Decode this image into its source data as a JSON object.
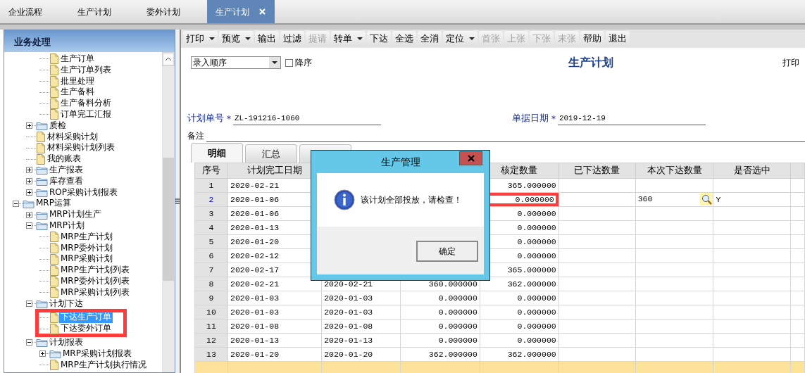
{
  "top_tabs": [
    {
      "label": "企业流程",
      "selected": false,
      "closable": false
    },
    {
      "label": "生产计划",
      "selected": false,
      "closable": false
    },
    {
      "label": "委外计划",
      "selected": false,
      "closable": false
    },
    {
      "label": "生产计划",
      "selected": true,
      "closable": true
    }
  ],
  "sidebar": {
    "title": "业务处理",
    "tree": [
      {
        "kind": "scrolled",
        "children": [
          {
            "kind": "scrolled",
            "children": [
              {
                "kind": "file",
                "label": "生产订单",
                "selected": false
              },
              {
                "kind": "file",
                "label": "生产订单列表",
                "selected": false
              },
              {
                "kind": "file",
                "label": "批里处理",
                "selected": false
              },
              {
                "kind": "file",
                "label": "生产备料",
                "selected": false
              },
              {
                "kind": "file",
                "label": "生产备料分析",
                "selected": false
              },
              {
                "kind": "file",
                "label": "订单完工汇报",
                "selected": false
              }
            ]
          },
          {
            "kind": "folder",
            "label": "质检",
            "expanded": false
          },
          {
            "kind": "file",
            "label": "材料采购计划",
            "selected": false
          },
          {
            "kind": "file",
            "label": "材料采购计划列表",
            "selected": false
          },
          {
            "kind": "file",
            "label": "我的账表",
            "selected": false
          },
          {
            "kind": "folder",
            "label": "生产报表",
            "expanded": false
          },
          {
            "kind": "folder",
            "label": "库存查看",
            "expanded": false
          },
          {
            "kind": "folder",
            "label": "ROP采购计划报表",
            "expanded": false
          }
        ]
      },
      {
        "kind": "folder",
        "label": "MRP运算",
        "expanded": true,
        "children": [
          {
            "kind": "folder",
            "label": "MRP计划生产",
            "expanded": false
          },
          {
            "kind": "folder",
            "label": "MRP计划",
            "expanded": true,
            "children": [
              {
                "kind": "file",
                "label": "MRP生产计划",
                "selected": false
              },
              {
                "kind": "file",
                "label": "MRP委外计划",
                "selected": false
              },
              {
                "kind": "file",
                "label": "MRP采购计划",
                "selected": false
              },
              {
                "kind": "file",
                "label": "MRP生产计划列表",
                "selected": false
              },
              {
                "kind": "file",
                "label": "MRP委外计划列表",
                "selected": false
              },
              {
                "kind": "file",
                "label": "MRP采购计划列表",
                "selected": false
              }
            ]
          },
          {
            "kind": "folder",
            "label": "计划下达",
            "expanded": true,
            "annotated": true,
            "children": [
              {
                "kind": "file",
                "label": "下达生产订单",
                "selected": true
              },
              {
                "kind": "file",
                "label": "下达委外订单",
                "selected": false
              }
            ]
          },
          {
            "kind": "folder",
            "label": "计划报表",
            "expanded": true,
            "children": [
              {
                "kind": "folder",
                "label": "MRP采购计划报表",
                "expanded": false
              },
              {
                "kind": "file",
                "label": "MRP生产计划执行情况",
                "selected": false
              }
            ]
          }
        ]
      }
    ]
  },
  "toolbar": [
    {
      "label": "打印",
      "dropdown": true,
      "disabled": false
    },
    {
      "label": "预览",
      "dropdown": true,
      "disabled": false
    },
    {
      "label": "输出",
      "dropdown": false,
      "disabled": false
    },
    {
      "label": "过滤",
      "dropdown": false,
      "disabled": false
    },
    {
      "label": "提请",
      "dropdown": false,
      "disabled": true
    },
    {
      "label": "转单",
      "dropdown": true,
      "disabled": false
    },
    {
      "label": "下达",
      "dropdown": false,
      "disabled": false
    },
    {
      "label": "全选",
      "dropdown": false,
      "disabled": false
    },
    {
      "label": "全消",
      "dropdown": false,
      "disabled": false
    },
    {
      "label": "定位",
      "dropdown": true,
      "disabled": false
    },
    {
      "label": "首张",
      "dropdown": false,
      "disabled": true
    },
    {
      "label": "上张",
      "dropdown": false,
      "disabled": true
    },
    {
      "label": "下张",
      "dropdown": false,
      "disabled": true
    },
    {
      "label": "末张",
      "dropdown": false,
      "disabled": true
    },
    {
      "label": "帮助",
      "dropdown": false,
      "disabled": false
    },
    {
      "label": "退出",
      "dropdown": false,
      "disabled": false
    }
  ],
  "sort": {
    "value": "录入顺序",
    "descending_label": "降序",
    "descending": false
  },
  "form_title": "生产计划",
  "print_label": "打印",
  "fields": {
    "plan_no": {
      "label": "计划单号",
      "marker": "*",
      "value": "ZL-191216-1060"
    },
    "doc_date": {
      "label": "单据日期",
      "marker": "*",
      "value": "2019-12-19"
    },
    "remark": {
      "label": "备注"
    }
  },
  "detail_tabs": [
    {
      "label": "明细",
      "selected": true
    },
    {
      "label": "汇总",
      "selected": false
    },
    {
      "selected": false
    }
  ],
  "table": {
    "columns": [
      "序号",
      "计划完工日期",
      null,
      null,
      "核定数量",
      "已下达数量",
      "本次下达数量",
      "是否选中",
      null
    ],
    "rows": [
      {
        "no": "1",
        "plan_date": "2020-02-21",
        "approved_qty": "365.000000",
        "current": false,
        "marked": false
      },
      {
        "no": "2",
        "plan_date": "2020-01-06",
        "approved_qty": "0.000000",
        "this_qty": "360",
        "selected_flag": "Y",
        "current": true,
        "marked": true
      },
      {
        "no": "3",
        "plan_date": "2020-01-06",
        "approved_qty": "0.000000",
        "current": false,
        "marked": false
      },
      {
        "no": "4",
        "plan_date": "2020-01-13",
        "approved_qty": "0.000000",
        "current": false,
        "marked": false
      },
      {
        "no": "5",
        "plan_date": "2020-01-20",
        "approved_qty": "0.000000",
        "current": false,
        "marked": false
      },
      {
        "no": "6",
        "plan_date": "2020-02-12",
        "approved_qty": "0.000000",
        "current": false,
        "marked": false
      },
      {
        "no": "7",
        "plan_date": "2020-02-17",
        "approved_qty": "365.000000",
        "current": false,
        "marked": false
      },
      {
        "no": "8",
        "plan_date": "2020-02-21",
        "column_3": "2020-02-21",
        "column_4": "360.000000",
        "approved_qty": "362.000000",
        "current": false,
        "marked": false
      },
      {
        "no": "9",
        "plan_date": "2020-01-03",
        "column_3": "2020-01-03",
        "column_4": "0.000000",
        "approved_qty": "0.000000",
        "current": false,
        "marked": false
      },
      {
        "no": "10",
        "plan_date": "2020-01-03",
        "column_3": "2020-01-03",
        "column_4": "0.000000",
        "approved_qty": "0.000000",
        "current": false,
        "marked": false
      },
      {
        "no": "11",
        "plan_date": "2020-01-08",
        "column_3": "2020-01-08",
        "column_4": "0.000000",
        "approved_qty": "0.000000",
        "current": false,
        "marked": false
      },
      {
        "no": "12",
        "plan_date": "2020-01-13",
        "column_3": "2020-01-13",
        "column_4": "0.000000",
        "approved_qty": "0.000000",
        "current": false,
        "marked": false
      },
      {
        "no": "13",
        "plan_date": "2020-01-20",
        "column_3": "2020-01-20",
        "column_4": "362.000000",
        "approved_qty": "362.000000",
        "current": false,
        "marked": false
      },
      {
        "shaded": true
      }
    ]
  },
  "dialog": {
    "title": "生产管理",
    "message": "该计划全部投放，请检查！",
    "button": "确定"
  }
}
